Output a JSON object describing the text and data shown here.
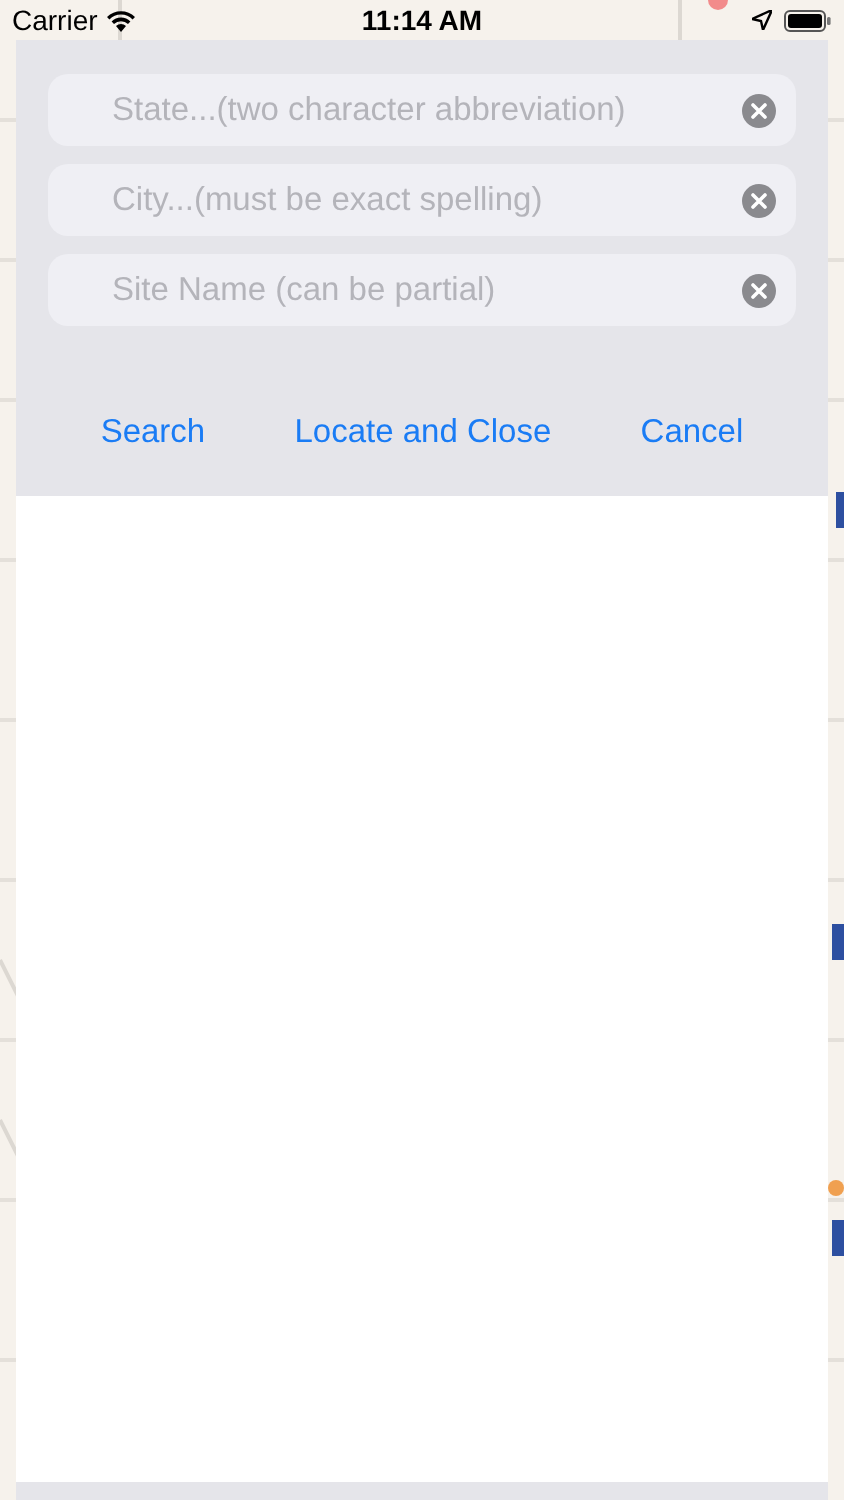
{
  "status_bar": {
    "carrier": "Carrier",
    "time": "11:14 AM"
  },
  "search_form": {
    "fields": [
      {
        "placeholder": "State...(two character abbreviation)"
      },
      {
        "placeholder": "City...(must be exact spelling)"
      },
      {
        "placeholder": "Site Name (can be partial)"
      }
    ],
    "buttons": [
      "Search",
      "Locate and Close",
      "Cancel"
    ]
  }
}
